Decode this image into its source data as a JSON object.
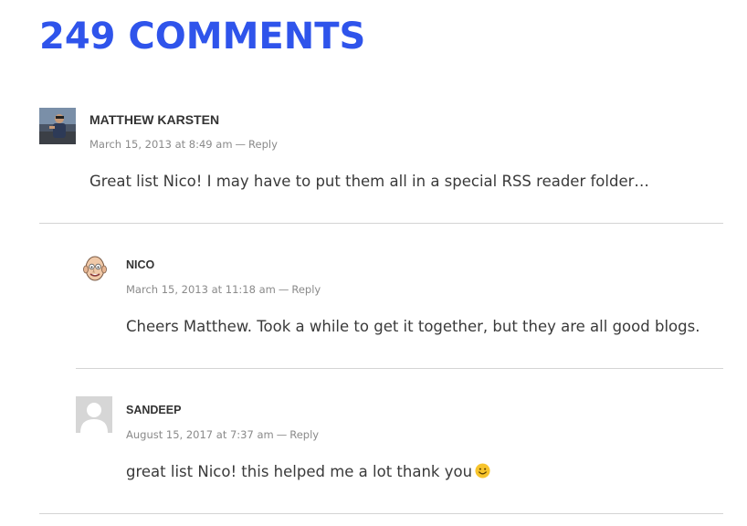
{
  "heading": "249 COMMENTS",
  "comments": [
    {
      "author": "MATTHEW KARSTEN",
      "date": "March 15, 2013 at 8:49 am",
      "separator": "—",
      "reply": "Reply",
      "text": "Great list Nico! I may have to put them all in a special RSS reader folder…"
    },
    {
      "author": "NICO",
      "date": "March 15, 2013 at 11:18 am",
      "separator": "—",
      "reply": "Reply",
      "text": "Cheers Matthew. Took a while to get it together, but they are all good blogs."
    },
    {
      "author": "SANDEEP",
      "date": "August 15, 2017 at 7:37 am",
      "separator": "—",
      "reply": "Reply",
      "text": "great list Nico! this helped me a lot thank you"
    }
  ],
  "colors": {
    "heading": "#2f54eb",
    "divider": "#d4d4d4",
    "meta": "#8a8a8a"
  },
  "icons": {
    "smiley": "smiley-emoji-icon"
  }
}
